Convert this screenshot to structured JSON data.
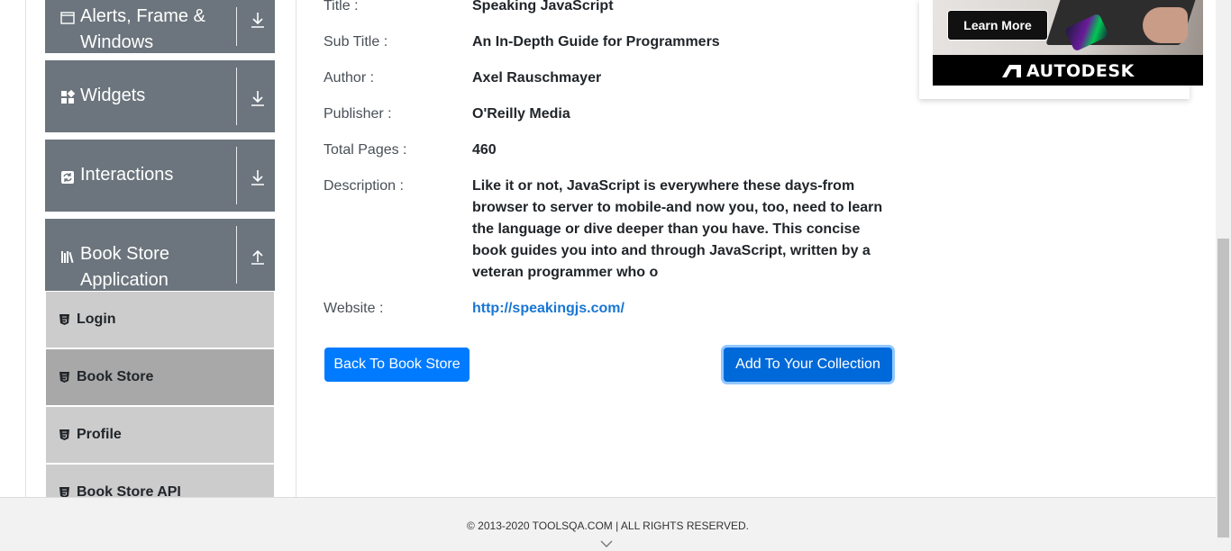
{
  "sidebar": {
    "groups": [
      {
        "label": "Alerts, Frame & Windows",
        "label_line1": "Alerts, Frame &",
        "label_line2": "Windows",
        "icon": "window-icon",
        "arrow": "download-arrow-icon"
      },
      {
        "label": "Widgets",
        "icon": "widgets-icon",
        "arrow": "download-arrow-icon"
      },
      {
        "label": "Interactions",
        "icon": "interactions-icon",
        "arrow": "download-arrow-icon"
      },
      {
        "label": "Book Store Application",
        "label_line1": "Book Store",
        "label_line2": "Application",
        "icon": "books-icon",
        "arrow": "upload-arrow-icon"
      }
    ],
    "items": [
      {
        "label": "Login",
        "icon": "html5-icon"
      },
      {
        "label": "Book Store",
        "icon": "html5-icon",
        "active": true
      },
      {
        "label": "Profile",
        "icon": "html5-icon"
      },
      {
        "label": "Book Store API",
        "icon": "html5-icon"
      }
    ]
  },
  "book": {
    "title_label": "Title :",
    "title": "Speaking JavaScript",
    "subtitle_label": "Sub Title :",
    "subtitle": "An In-Depth Guide for Programmers",
    "author_label": "Author :",
    "author": "Axel Rauschmayer",
    "publisher_label": "Publisher :",
    "publisher": "O'Reilly Media",
    "pages_label": "Total Pages :",
    "pages": "460",
    "description_label": "Description :",
    "description": "Like it or not, JavaScript is everywhere these days-from browser to server to mobile-and now you, too, need to learn the language or dive deeper than you have. This concise book guides you into and through JavaScript, written by a veteran programmer who o",
    "website_label": "Website :",
    "website": "http://speakingjs.com/"
  },
  "actions": {
    "back_label": "Back To Book Store",
    "add_label": "Add To Your Collection"
  },
  "ad": {
    "cta_label": "Learn More",
    "brand": "AUTODESK"
  },
  "footer": {
    "copyright": "© 2013-2020 TOOLSQA.COM | ALL RIGHTS RESERVED."
  },
  "colors": {
    "sidebar_group": "#6c757d",
    "sidebar_item": "#cccccc",
    "sidebar_item_active": "#a8a8a8",
    "primary_button": "#007bff",
    "link": "#1976d2"
  }
}
